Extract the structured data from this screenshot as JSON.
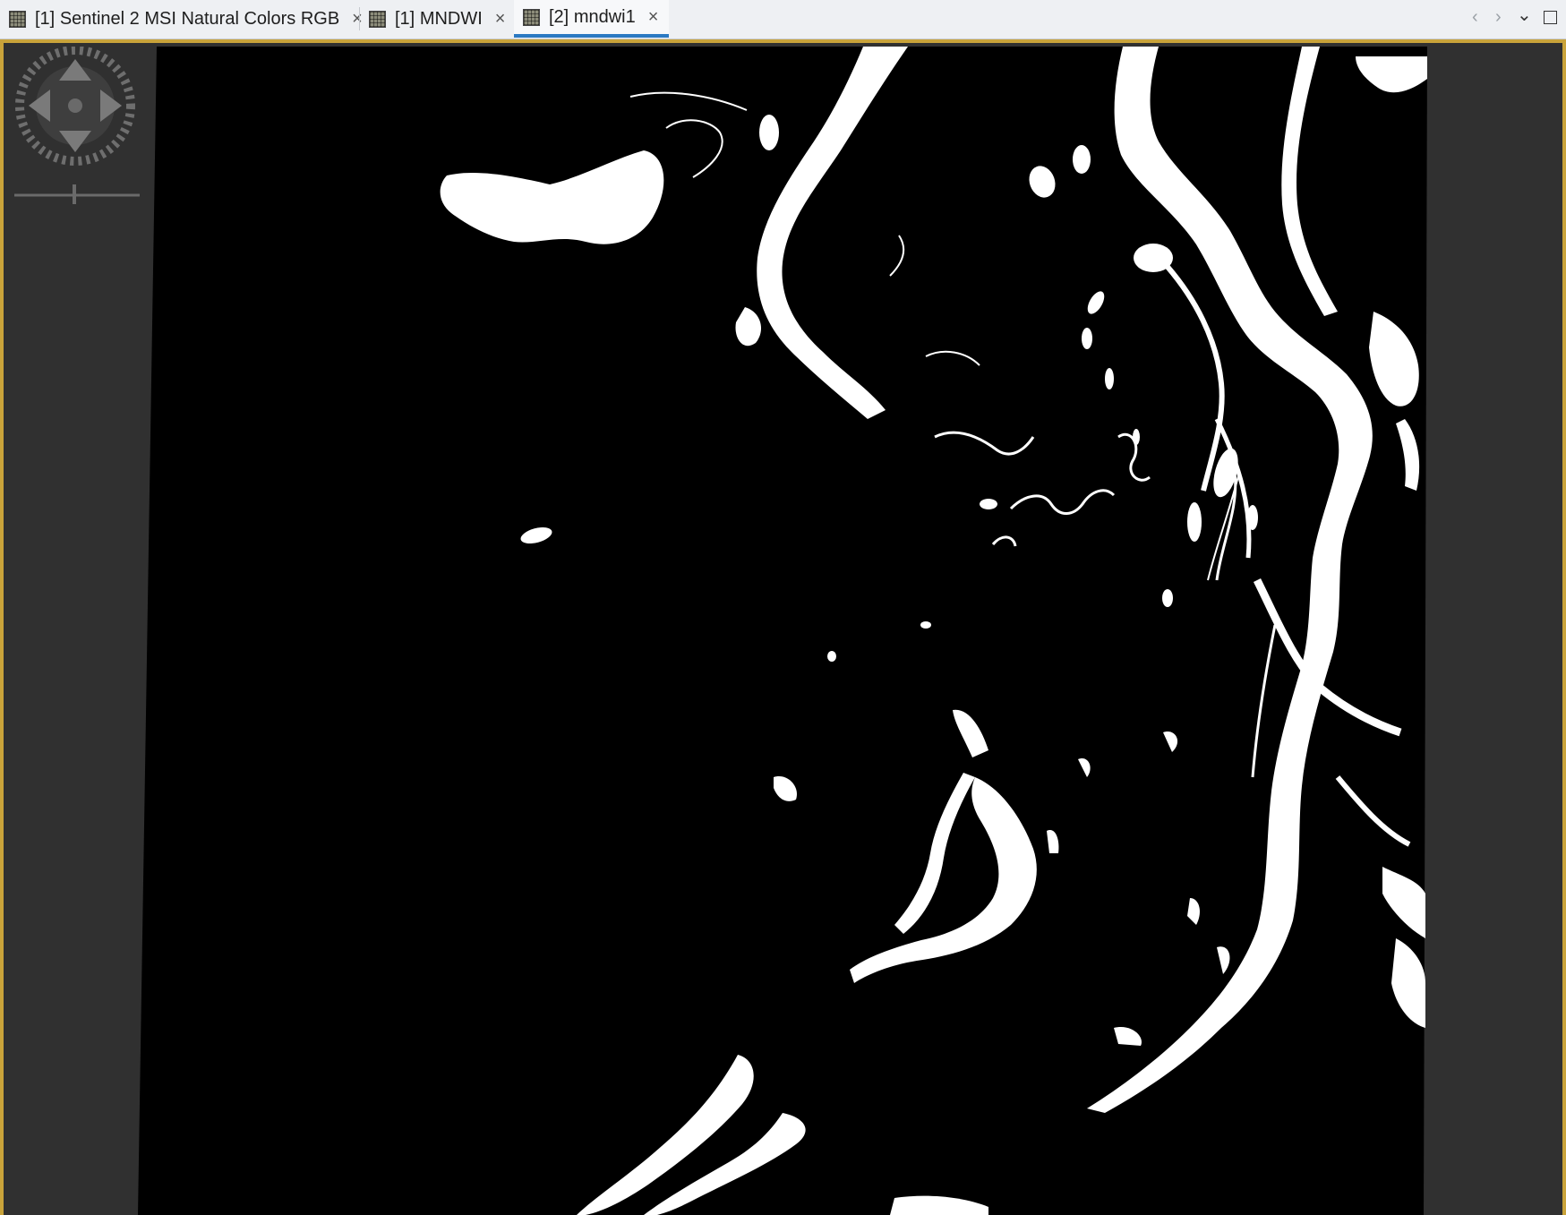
{
  "tabs": [
    {
      "index_label": "[1]",
      "name": "Sentinel 2 MSI Natural Colors RGB",
      "close": "×",
      "active": false
    },
    {
      "index_label": "[1]",
      "name": "MNDWI",
      "close": "×",
      "active": false
    },
    {
      "index_label": "[2]",
      "name": "mndwi1",
      "close": "×",
      "active": true
    }
  ],
  "tab_controls": {
    "prev": "‹",
    "next": "›",
    "list": "⌄"
  },
  "view": {
    "background_color": "#303030",
    "frame_color": "#c9a33a",
    "image_colors": {
      "land": "#000000",
      "water": "#ffffff"
    }
  },
  "navigation_control": {
    "icons": [
      "pan-up-icon",
      "pan-down-icon",
      "pan-left-icon",
      "pan-right-icon",
      "rotation-ring-icon",
      "zoom-slider-icon"
    ]
  }
}
